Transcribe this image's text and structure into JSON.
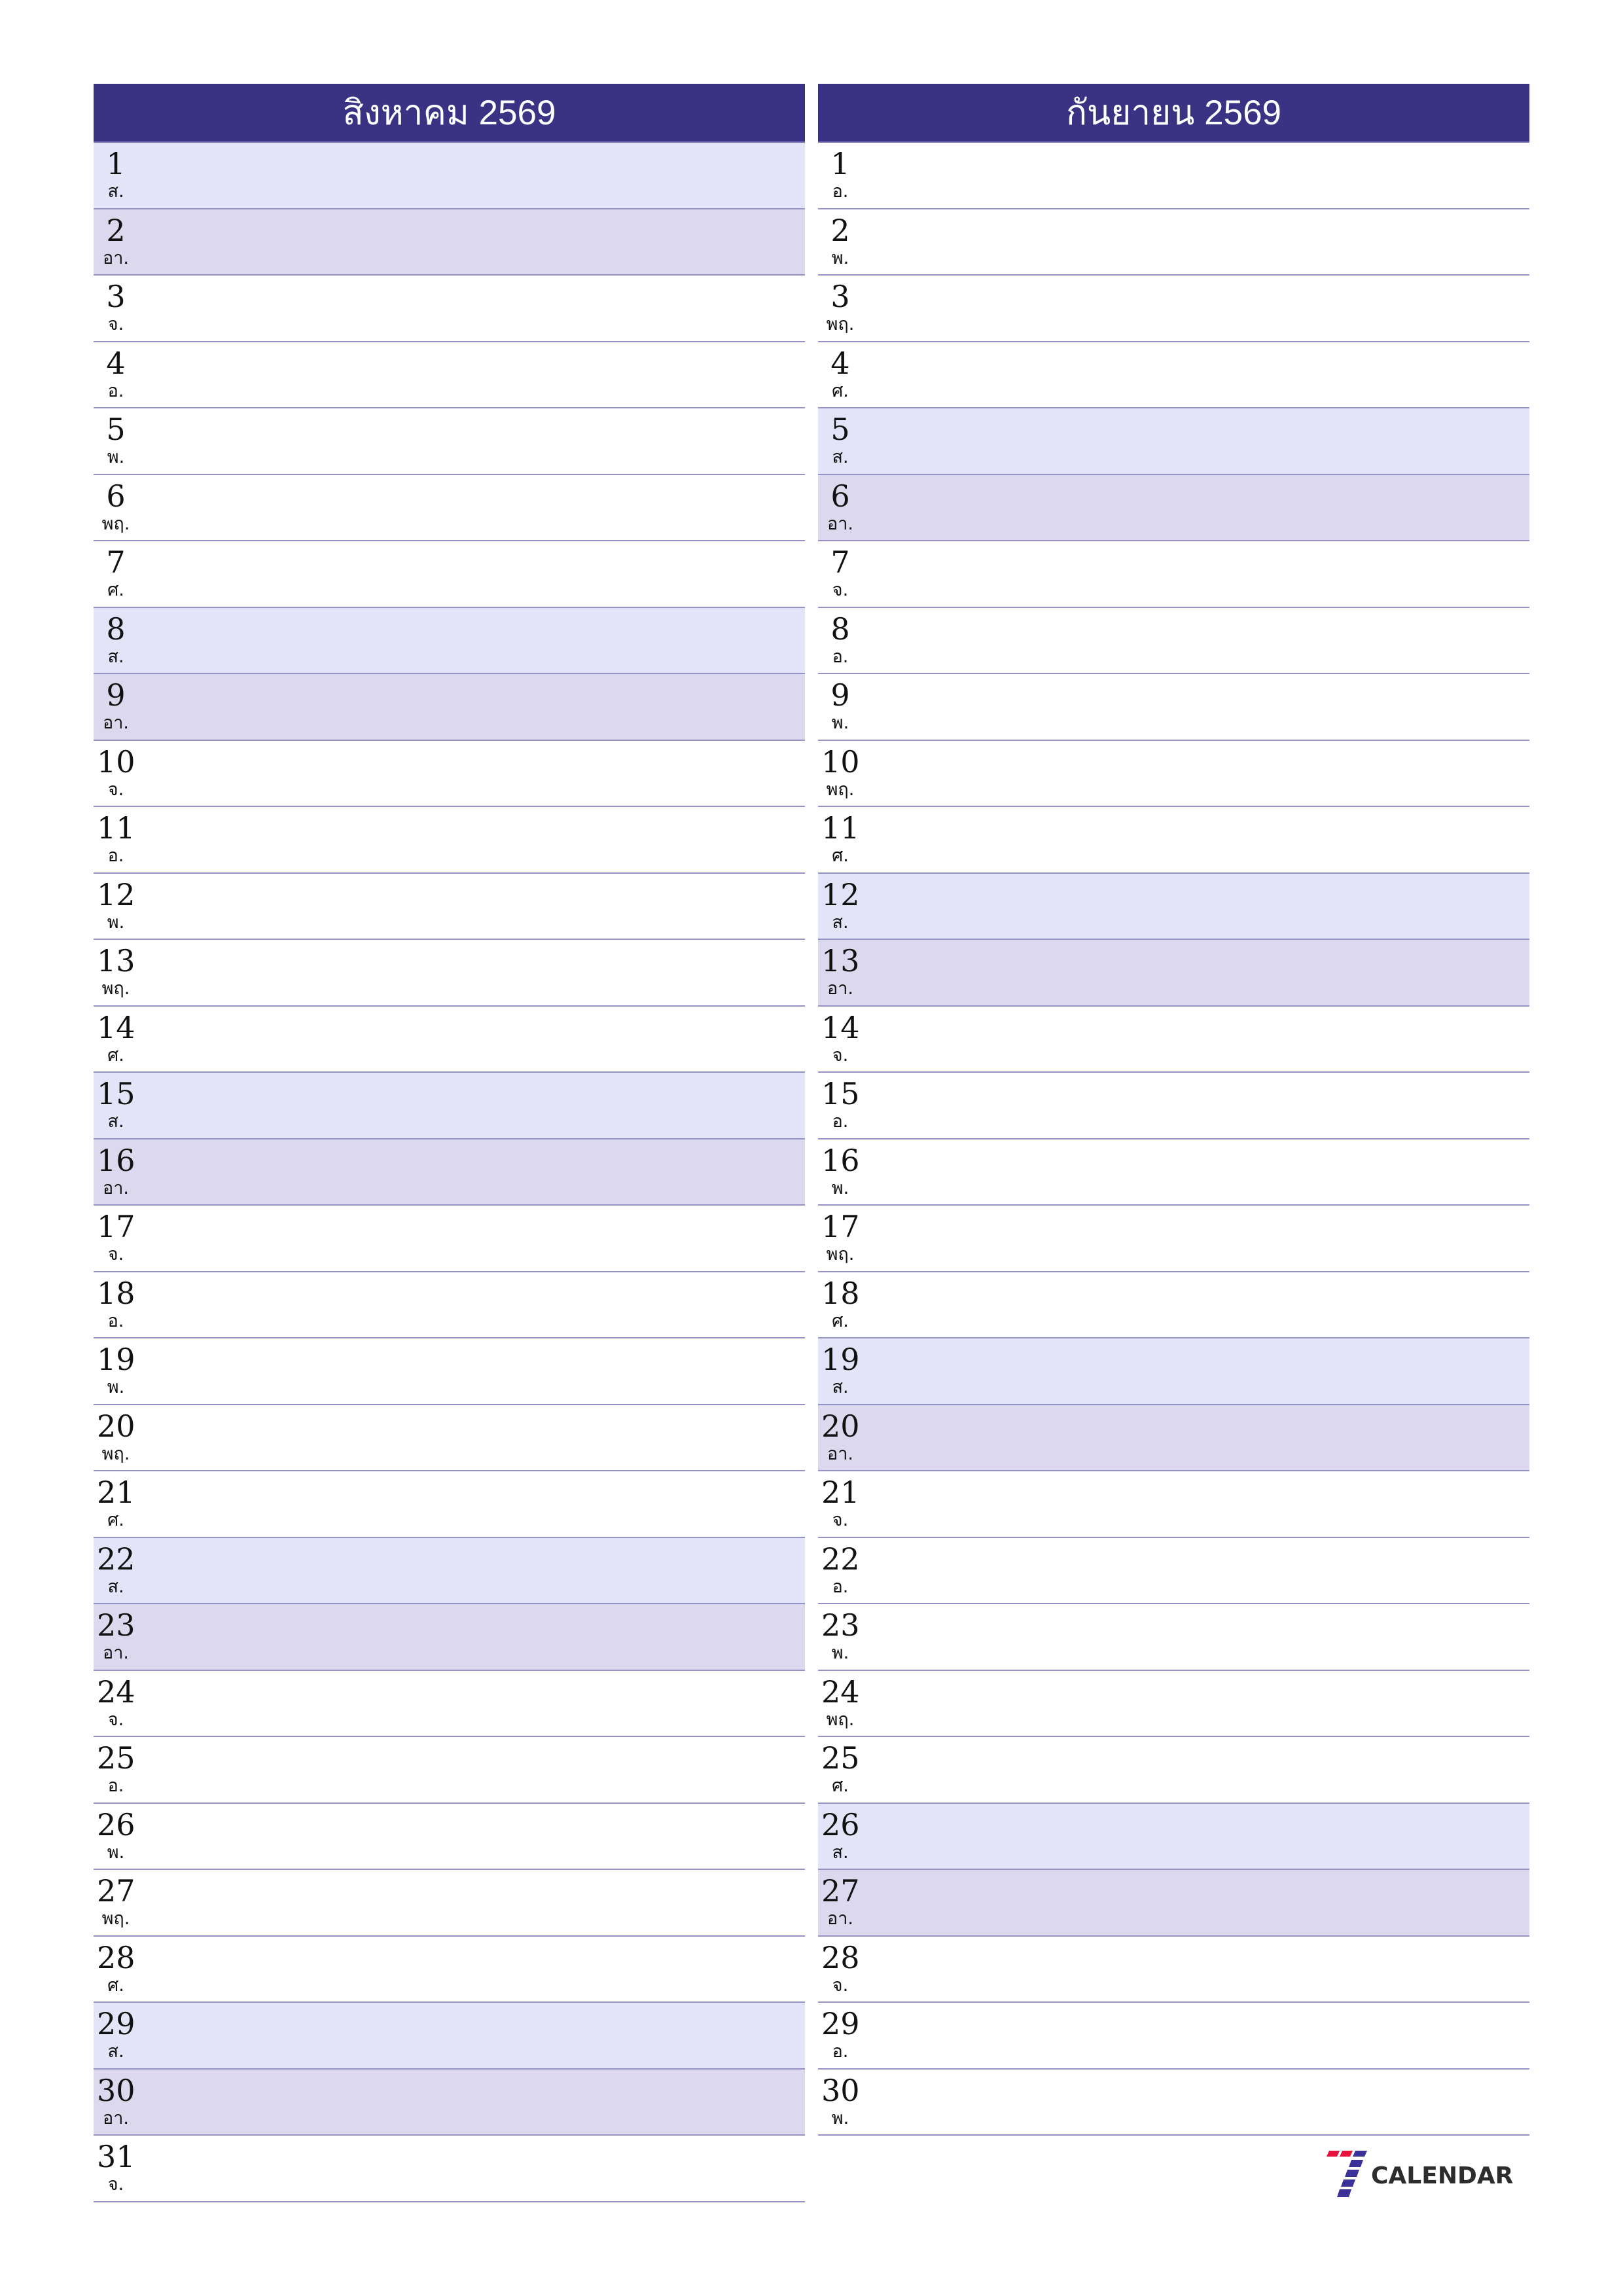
{
  "months": [
    {
      "title": "สิงหาคม 2569",
      "days": [
        {
          "num": "1",
          "name": "ส.",
          "type": "sat"
        },
        {
          "num": "2",
          "name": "อา.",
          "type": "sun"
        },
        {
          "num": "3",
          "name": "จ.",
          "type": "weekday"
        },
        {
          "num": "4",
          "name": "อ.",
          "type": "weekday"
        },
        {
          "num": "5",
          "name": "พ.",
          "type": "weekday"
        },
        {
          "num": "6",
          "name": "พฤ.",
          "type": "weekday"
        },
        {
          "num": "7",
          "name": "ศ.",
          "type": "weekday"
        },
        {
          "num": "8",
          "name": "ส.",
          "type": "sat"
        },
        {
          "num": "9",
          "name": "อา.",
          "type": "sun"
        },
        {
          "num": "10",
          "name": "จ.",
          "type": "weekday"
        },
        {
          "num": "11",
          "name": "อ.",
          "type": "weekday"
        },
        {
          "num": "12",
          "name": "พ.",
          "type": "weekday"
        },
        {
          "num": "13",
          "name": "พฤ.",
          "type": "weekday"
        },
        {
          "num": "14",
          "name": "ศ.",
          "type": "weekday"
        },
        {
          "num": "15",
          "name": "ส.",
          "type": "sat"
        },
        {
          "num": "16",
          "name": "อา.",
          "type": "sun"
        },
        {
          "num": "17",
          "name": "จ.",
          "type": "weekday"
        },
        {
          "num": "18",
          "name": "อ.",
          "type": "weekday"
        },
        {
          "num": "19",
          "name": "พ.",
          "type": "weekday"
        },
        {
          "num": "20",
          "name": "พฤ.",
          "type": "weekday"
        },
        {
          "num": "21",
          "name": "ศ.",
          "type": "weekday"
        },
        {
          "num": "22",
          "name": "ส.",
          "type": "sat"
        },
        {
          "num": "23",
          "name": "อา.",
          "type": "sun"
        },
        {
          "num": "24",
          "name": "จ.",
          "type": "weekday"
        },
        {
          "num": "25",
          "name": "อ.",
          "type": "weekday"
        },
        {
          "num": "26",
          "name": "พ.",
          "type": "weekday"
        },
        {
          "num": "27",
          "name": "พฤ.",
          "type": "weekday"
        },
        {
          "num": "28",
          "name": "ศ.",
          "type": "weekday"
        },
        {
          "num": "29",
          "name": "ส.",
          "type": "sat"
        },
        {
          "num": "30",
          "name": "อา.",
          "type": "sun"
        },
        {
          "num": "31",
          "name": "จ.",
          "type": "weekday"
        }
      ]
    },
    {
      "title": "กันยายน 2569",
      "days": [
        {
          "num": "1",
          "name": "อ.",
          "type": "weekday"
        },
        {
          "num": "2",
          "name": "พ.",
          "type": "weekday"
        },
        {
          "num": "3",
          "name": "พฤ.",
          "type": "weekday"
        },
        {
          "num": "4",
          "name": "ศ.",
          "type": "weekday"
        },
        {
          "num": "5",
          "name": "ส.",
          "type": "sat"
        },
        {
          "num": "6",
          "name": "อา.",
          "type": "sun"
        },
        {
          "num": "7",
          "name": "จ.",
          "type": "weekday"
        },
        {
          "num": "8",
          "name": "อ.",
          "type": "weekday"
        },
        {
          "num": "9",
          "name": "พ.",
          "type": "weekday"
        },
        {
          "num": "10",
          "name": "พฤ.",
          "type": "weekday"
        },
        {
          "num": "11",
          "name": "ศ.",
          "type": "weekday"
        },
        {
          "num": "12",
          "name": "ส.",
          "type": "sat"
        },
        {
          "num": "13",
          "name": "อา.",
          "type": "sun"
        },
        {
          "num": "14",
          "name": "จ.",
          "type": "weekday"
        },
        {
          "num": "15",
          "name": "อ.",
          "type": "weekday"
        },
        {
          "num": "16",
          "name": "พ.",
          "type": "weekday"
        },
        {
          "num": "17",
          "name": "พฤ.",
          "type": "weekday"
        },
        {
          "num": "18",
          "name": "ศ.",
          "type": "weekday"
        },
        {
          "num": "19",
          "name": "ส.",
          "type": "sat"
        },
        {
          "num": "20",
          "name": "อา.",
          "type": "sun"
        },
        {
          "num": "21",
          "name": "จ.",
          "type": "weekday"
        },
        {
          "num": "22",
          "name": "อ.",
          "type": "weekday"
        },
        {
          "num": "23",
          "name": "พ.",
          "type": "weekday"
        },
        {
          "num": "24",
          "name": "พฤ.",
          "type": "weekday"
        },
        {
          "num": "25",
          "name": "ศ.",
          "type": "weekday"
        },
        {
          "num": "26",
          "name": "ส.",
          "type": "sat"
        },
        {
          "num": "27",
          "name": "อา.",
          "type": "sun"
        },
        {
          "num": "28",
          "name": "จ.",
          "type": "weekday"
        },
        {
          "num": "29",
          "name": "อ.",
          "type": "weekday"
        },
        {
          "num": "30",
          "name": "พ.",
          "type": "weekday"
        }
      ]
    }
  ],
  "colors": {
    "header_bg": "#3a3283",
    "saturday_bg": "#e4e4f8",
    "sunday_bg": "#dcd8ee",
    "divider": "#9592c4",
    "logo_red": "#e8123c",
    "logo_blue": "#3a3298",
    "logo_text": "#2d2d2d"
  },
  "logo": {
    "icon": "seven-logo-icon",
    "text": "CALENDAR"
  }
}
